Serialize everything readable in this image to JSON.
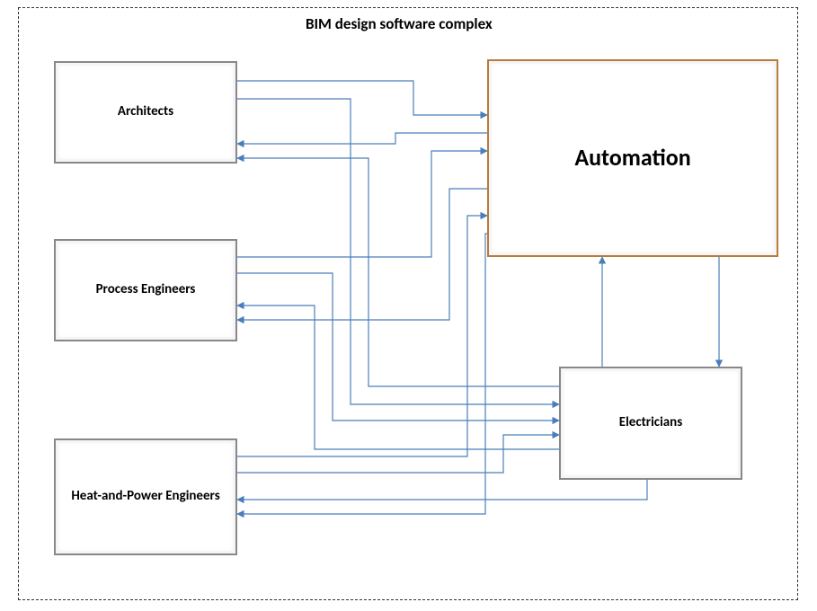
{
  "diagram": {
    "title": "BIM design software complex",
    "nodes": {
      "architects": {
        "label": "Architects"
      },
      "process_engineers": {
        "label": "Process Engineers"
      },
      "heat_power": {
        "label": "Heat-and-Power Engineers"
      },
      "automation": {
        "label": "Automation"
      },
      "electricians": {
        "label": "Electricians"
      }
    },
    "colors": {
      "arrow": "#4a7ebb",
      "automation_border": "#b97a3a"
    },
    "connections": [
      {
        "from": "architects",
        "to": "automation",
        "bidirectional": true
      },
      {
        "from": "architects",
        "to": "electricians",
        "bidirectional": true
      },
      {
        "from": "process_engineers",
        "to": "automation",
        "bidirectional": true
      },
      {
        "from": "process_engineers",
        "to": "electricians",
        "bidirectional": true
      },
      {
        "from": "heat_power",
        "to": "automation",
        "bidirectional": true
      },
      {
        "from": "heat_power",
        "to": "electricians",
        "bidirectional": true
      },
      {
        "from": "automation",
        "to": "electricians",
        "bidirectional": true
      }
    ]
  }
}
